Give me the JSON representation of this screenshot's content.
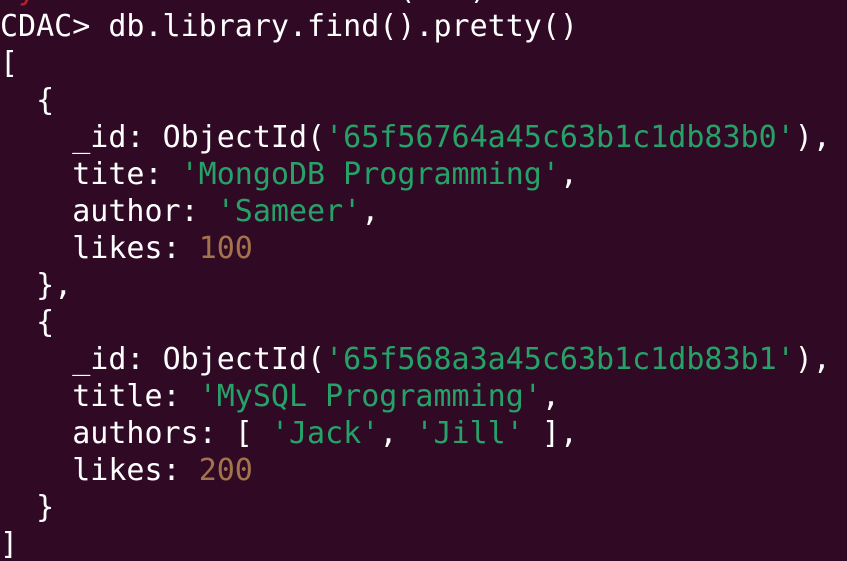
{
  "colors": {
    "background": "#300a24",
    "foreground": "#ffffff",
    "string": "#26a269",
    "number": "#a2734c",
    "partial_prompt": "#c01c28"
  },
  "terminal": {
    "partial_top": {
      "red": "ty",
      "rest": "        .           (   )  ."
    },
    "prompt": "CDAC> ",
    "command": "db.library.find().pretty()",
    "lines": {
      "open_array": "[",
      "doc1_open": "  {",
      "doc1_id_key": "    _id: ",
      "doc1_id_fn": "ObjectId(",
      "doc1_id_val": "'65f56764a45c63b1c1db83b0'",
      "doc1_id_close": "),",
      "doc1_title_key": "    tite: ",
      "doc1_title_val": "'MongoDB Programming'",
      "doc1_title_comma": ",",
      "doc1_author_key": "    author: ",
      "doc1_author_val": "'Sameer'",
      "doc1_author_comma": ",",
      "doc1_likes_key": "    likes: ",
      "doc1_likes_val": "100",
      "doc1_close": "  },",
      "doc2_open": "  {",
      "doc2_id_key": "    _id: ",
      "doc2_id_fn": "ObjectId(",
      "doc2_id_val": "'65f568a3a45c63b1c1db83b1'",
      "doc2_id_close": "),",
      "doc2_title_key": "    title: ",
      "doc2_title_val": "'MySQL Programming'",
      "doc2_title_comma": ",",
      "doc2_authors_key": "    authors: [ ",
      "doc2_authors_val1": "'Jack'",
      "doc2_authors_sep": ", ",
      "doc2_authors_val2": "'Jill'",
      "doc2_authors_close": " ],",
      "doc2_likes_key": "    likes: ",
      "doc2_likes_val": "200",
      "doc2_close": "  }",
      "close_array": "]"
    }
  }
}
